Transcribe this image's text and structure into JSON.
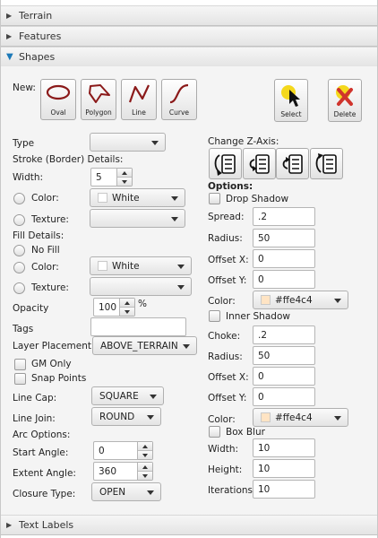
{
  "accordion": {
    "terrain": "Terrain",
    "features": "Features",
    "shapes": "Shapes",
    "text_labels": "Text Labels"
  },
  "new_label": "New:",
  "tools": [
    "Oval",
    "Polygon",
    "Line",
    "Curve"
  ],
  "select_label": "Select",
  "delete_label": "Delete",
  "type": {
    "label": "Type",
    "value": ""
  },
  "stroke": {
    "header": "Stroke (Border) Details:",
    "width_label": "Width:",
    "width_value": "5",
    "color_label": "Color:",
    "color_value": "White",
    "texture_label": "Texture:",
    "texture_value": ""
  },
  "fill": {
    "header": "Fill Details:",
    "nofill_label": "No Fill",
    "color_label": "Color:",
    "color_value": "White",
    "texture_label": "Texture:",
    "texture_value": ""
  },
  "opacity": {
    "label": "Opacity",
    "value": "100",
    "unit": "%"
  },
  "tags": {
    "label": "Tags",
    "value": ""
  },
  "layer": {
    "label": "Layer Placement:",
    "value": "ABOVE_TERRAIN"
  },
  "gm_only": "GM Only",
  "snap_points": "Snap Points",
  "line_cap": {
    "label": "Line Cap:",
    "value": "SQUARE"
  },
  "line_join": {
    "label": "Line Join:",
    "value": "ROUND"
  },
  "arc": {
    "header": "Arc Options:",
    "start_label": "Start Angle:",
    "start_value": "0",
    "extent_label": "Extent Angle:",
    "extent_value": "360",
    "closure_label": "Closure Type:",
    "closure_value": "OPEN"
  },
  "zaxis_label": "Change Z-Axis:",
  "options_header": "Options:",
  "drop_shadow": {
    "label": "Drop Shadow",
    "spread_label": "Spread:",
    "spread_value": ".2",
    "radius_label": "Radius:",
    "radius_value": "50",
    "offx_label": "Offset X:",
    "offx_value": "0",
    "offy_label": "Offset Y:",
    "offy_value": "0",
    "color_label": "Color:",
    "color_value": "#ffe4c4"
  },
  "inner_shadow": {
    "label": "Inner Shadow",
    "choke_label": "Choke:",
    "choke_value": ".2",
    "radius_label": "Radius:",
    "radius_value": "50",
    "offx_label": "Offset X:",
    "offx_value": "0",
    "offy_label": "Offset Y:",
    "offy_value": "0",
    "color_label": "Color:",
    "color_value": "#ffe4c4"
  },
  "box_blur": {
    "label": "Box Blur",
    "width_label": "Width:",
    "width_value": "10",
    "height_label": "Height:",
    "height_value": "10",
    "iter_label": "Iterations:",
    "iter_value": "10"
  },
  "colors": {
    "accent": "#1c79b8",
    "shape_red": "#8b1a1a",
    "swatch_bisque": "#ffe4c4",
    "select_yellow": "#f4d81c",
    "delete_red": "#d0342c"
  }
}
